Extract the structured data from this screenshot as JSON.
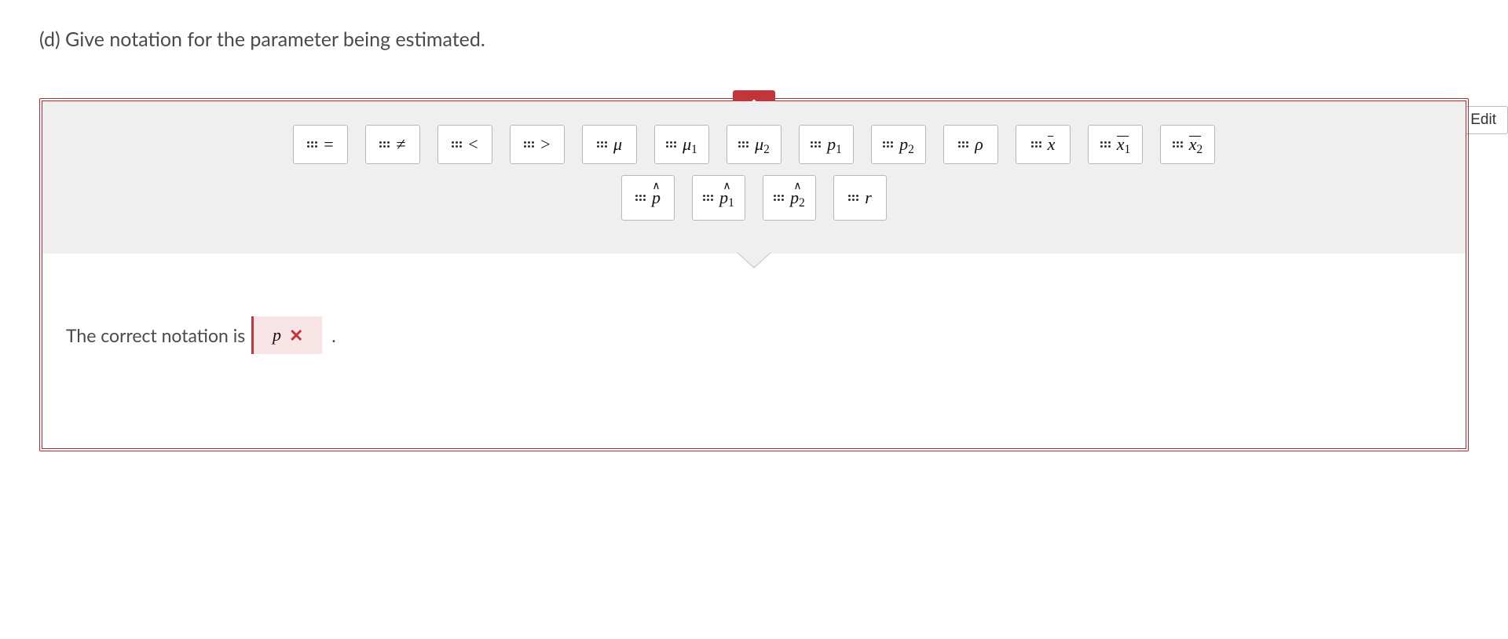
{
  "question": "(d) Give notation for the parameter being estimated.",
  "edit_label": "Edit",
  "palette_row1": [
    {
      "name": "equals",
      "display": "=",
      "upright": true
    },
    {
      "name": "not-equals",
      "display": "≠",
      "upright": true
    },
    {
      "name": "less-than",
      "display": "<",
      "upright": true
    },
    {
      "name": "greater-than",
      "display": ">",
      "upright": true
    },
    {
      "name": "mu",
      "display": "μ"
    },
    {
      "name": "mu1",
      "display": "μ",
      "sub": "1"
    },
    {
      "name": "mu2",
      "display": "μ",
      "sub": "2"
    },
    {
      "name": "p1",
      "display": "p",
      "sub": "1"
    },
    {
      "name": "p2",
      "display": "p",
      "sub": "2"
    },
    {
      "name": "rho",
      "display": "ρ"
    },
    {
      "name": "xbar",
      "display": "x",
      "bar": true
    },
    {
      "name": "xbar1",
      "display": "x",
      "bar": true,
      "sub": "1"
    },
    {
      "name": "xbar2",
      "display": "x",
      "bar": true,
      "sub": "2"
    }
  ],
  "palette_row2": [
    {
      "name": "phat",
      "display": "p",
      "hat": true
    },
    {
      "name": "phat1",
      "display": "p",
      "hat": true,
      "sub": "1"
    },
    {
      "name": "phat2",
      "display": "p",
      "hat": true,
      "sub": "2"
    },
    {
      "name": "r",
      "display": "r"
    }
  ],
  "answer": {
    "prefix": "The correct notation is",
    "dropped_symbol": "p",
    "correct": false,
    "suffix": "."
  }
}
